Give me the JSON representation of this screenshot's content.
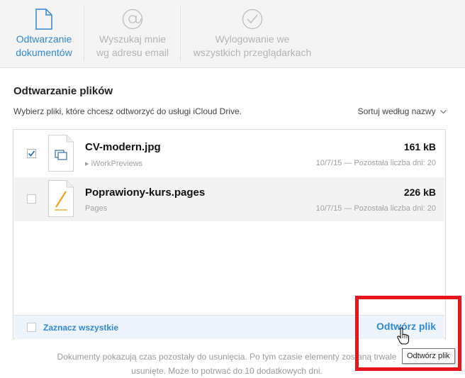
{
  "tabs": [
    {
      "label_line1": "Odtwarzanie",
      "label_line2": "dokumentów",
      "icon": "document-icon",
      "active": true
    },
    {
      "label_line1": "Wyszukaj mnie",
      "label_line2": "wg adresu email",
      "icon": "at-sign-icon",
      "active": false
    },
    {
      "label_line1": "Wylogowanie we",
      "label_line2": "wszystkich przeglądarkach",
      "icon": "checkmark-circle-icon",
      "active": false
    }
  ],
  "main": {
    "title": "Odtwarzanie plików",
    "subtitle": "Wybierz pliki, które chcesz odtworzyć do usługi iCloud Drive.",
    "sort_label": "Sortuj według nazwy"
  },
  "files": [
    {
      "name": "CV-modern.jpg",
      "source": "▸ iWorkPreviews",
      "size": "161 kB",
      "meta": "10/7/15 — Pozostała liczba dni: 20",
      "checked": true,
      "icon": "image-document-icon"
    },
    {
      "name": "Poprawiony-kurs.pages",
      "source": "Pages",
      "size": "226 kB",
      "meta": "10/7/15 — Pozostała liczba dni: 20",
      "checked": false,
      "icon": "pages-document-icon"
    }
  ],
  "footer": {
    "select_all": "Zaznacz wszystkie",
    "restore_button": "Odtwórz plik"
  },
  "note": {
    "line1": "Dokumenty pokazują czas pozostały do usunięcia. Po tym czasie elementy zostaną trwale",
    "line2": "usunięte. Może to potrwać do 10 dodatkowych dni."
  },
  "tooltip": "Odtwórz plik",
  "colors": {
    "accent": "#2f88d4",
    "highlight": "#e8141b"
  }
}
